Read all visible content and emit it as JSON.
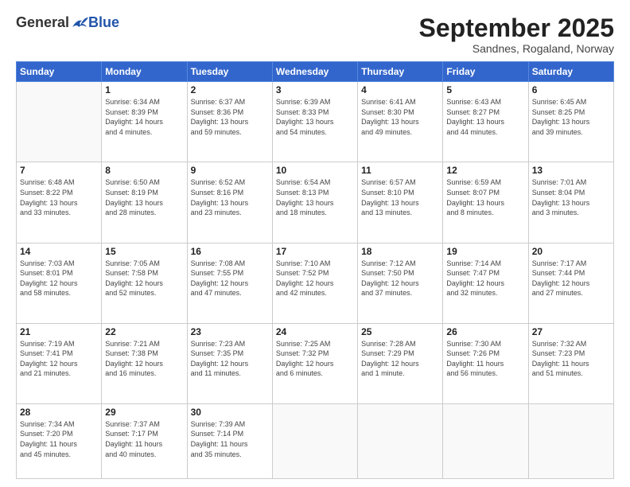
{
  "logo": {
    "general": "General",
    "blue": "Blue"
  },
  "header": {
    "month": "September 2025",
    "location": "Sandnes, Rogaland, Norway"
  },
  "weekdays": [
    "Sunday",
    "Monday",
    "Tuesday",
    "Wednesday",
    "Thursday",
    "Friday",
    "Saturday"
  ],
  "weeks": [
    [
      {
        "day": "",
        "info": ""
      },
      {
        "day": "1",
        "info": "Sunrise: 6:34 AM\nSunset: 8:39 PM\nDaylight: 14 hours\nand 4 minutes."
      },
      {
        "day": "2",
        "info": "Sunrise: 6:37 AM\nSunset: 8:36 PM\nDaylight: 13 hours\nand 59 minutes."
      },
      {
        "day": "3",
        "info": "Sunrise: 6:39 AM\nSunset: 8:33 PM\nDaylight: 13 hours\nand 54 minutes."
      },
      {
        "day": "4",
        "info": "Sunrise: 6:41 AM\nSunset: 8:30 PM\nDaylight: 13 hours\nand 49 minutes."
      },
      {
        "day": "5",
        "info": "Sunrise: 6:43 AM\nSunset: 8:27 PM\nDaylight: 13 hours\nand 44 minutes."
      },
      {
        "day": "6",
        "info": "Sunrise: 6:45 AM\nSunset: 8:25 PM\nDaylight: 13 hours\nand 39 minutes."
      }
    ],
    [
      {
        "day": "7",
        "info": "Sunrise: 6:48 AM\nSunset: 8:22 PM\nDaylight: 13 hours\nand 33 minutes."
      },
      {
        "day": "8",
        "info": "Sunrise: 6:50 AM\nSunset: 8:19 PM\nDaylight: 13 hours\nand 28 minutes."
      },
      {
        "day": "9",
        "info": "Sunrise: 6:52 AM\nSunset: 8:16 PM\nDaylight: 13 hours\nand 23 minutes."
      },
      {
        "day": "10",
        "info": "Sunrise: 6:54 AM\nSunset: 8:13 PM\nDaylight: 13 hours\nand 18 minutes."
      },
      {
        "day": "11",
        "info": "Sunrise: 6:57 AM\nSunset: 8:10 PM\nDaylight: 13 hours\nand 13 minutes."
      },
      {
        "day": "12",
        "info": "Sunrise: 6:59 AM\nSunset: 8:07 PM\nDaylight: 13 hours\nand 8 minutes."
      },
      {
        "day": "13",
        "info": "Sunrise: 7:01 AM\nSunset: 8:04 PM\nDaylight: 13 hours\nand 3 minutes."
      }
    ],
    [
      {
        "day": "14",
        "info": "Sunrise: 7:03 AM\nSunset: 8:01 PM\nDaylight: 12 hours\nand 58 minutes."
      },
      {
        "day": "15",
        "info": "Sunrise: 7:05 AM\nSunset: 7:58 PM\nDaylight: 12 hours\nand 52 minutes."
      },
      {
        "day": "16",
        "info": "Sunrise: 7:08 AM\nSunset: 7:55 PM\nDaylight: 12 hours\nand 47 minutes."
      },
      {
        "day": "17",
        "info": "Sunrise: 7:10 AM\nSunset: 7:52 PM\nDaylight: 12 hours\nand 42 minutes."
      },
      {
        "day": "18",
        "info": "Sunrise: 7:12 AM\nSunset: 7:50 PM\nDaylight: 12 hours\nand 37 minutes."
      },
      {
        "day": "19",
        "info": "Sunrise: 7:14 AM\nSunset: 7:47 PM\nDaylight: 12 hours\nand 32 minutes."
      },
      {
        "day": "20",
        "info": "Sunrise: 7:17 AM\nSunset: 7:44 PM\nDaylight: 12 hours\nand 27 minutes."
      }
    ],
    [
      {
        "day": "21",
        "info": "Sunrise: 7:19 AM\nSunset: 7:41 PM\nDaylight: 12 hours\nand 21 minutes."
      },
      {
        "day": "22",
        "info": "Sunrise: 7:21 AM\nSunset: 7:38 PM\nDaylight: 12 hours\nand 16 minutes."
      },
      {
        "day": "23",
        "info": "Sunrise: 7:23 AM\nSunset: 7:35 PM\nDaylight: 12 hours\nand 11 minutes."
      },
      {
        "day": "24",
        "info": "Sunrise: 7:25 AM\nSunset: 7:32 PM\nDaylight: 12 hours\nand 6 minutes."
      },
      {
        "day": "25",
        "info": "Sunrise: 7:28 AM\nSunset: 7:29 PM\nDaylight: 12 hours\nand 1 minute."
      },
      {
        "day": "26",
        "info": "Sunrise: 7:30 AM\nSunset: 7:26 PM\nDaylight: 11 hours\nand 56 minutes."
      },
      {
        "day": "27",
        "info": "Sunrise: 7:32 AM\nSunset: 7:23 PM\nDaylight: 11 hours\nand 51 minutes."
      }
    ],
    [
      {
        "day": "28",
        "info": "Sunrise: 7:34 AM\nSunset: 7:20 PM\nDaylight: 11 hours\nand 45 minutes."
      },
      {
        "day": "29",
        "info": "Sunrise: 7:37 AM\nSunset: 7:17 PM\nDaylight: 11 hours\nand 40 minutes."
      },
      {
        "day": "30",
        "info": "Sunrise: 7:39 AM\nSunset: 7:14 PM\nDaylight: 11 hours\nand 35 minutes."
      },
      {
        "day": "",
        "info": ""
      },
      {
        "day": "",
        "info": ""
      },
      {
        "day": "",
        "info": ""
      },
      {
        "day": "",
        "info": ""
      }
    ]
  ]
}
